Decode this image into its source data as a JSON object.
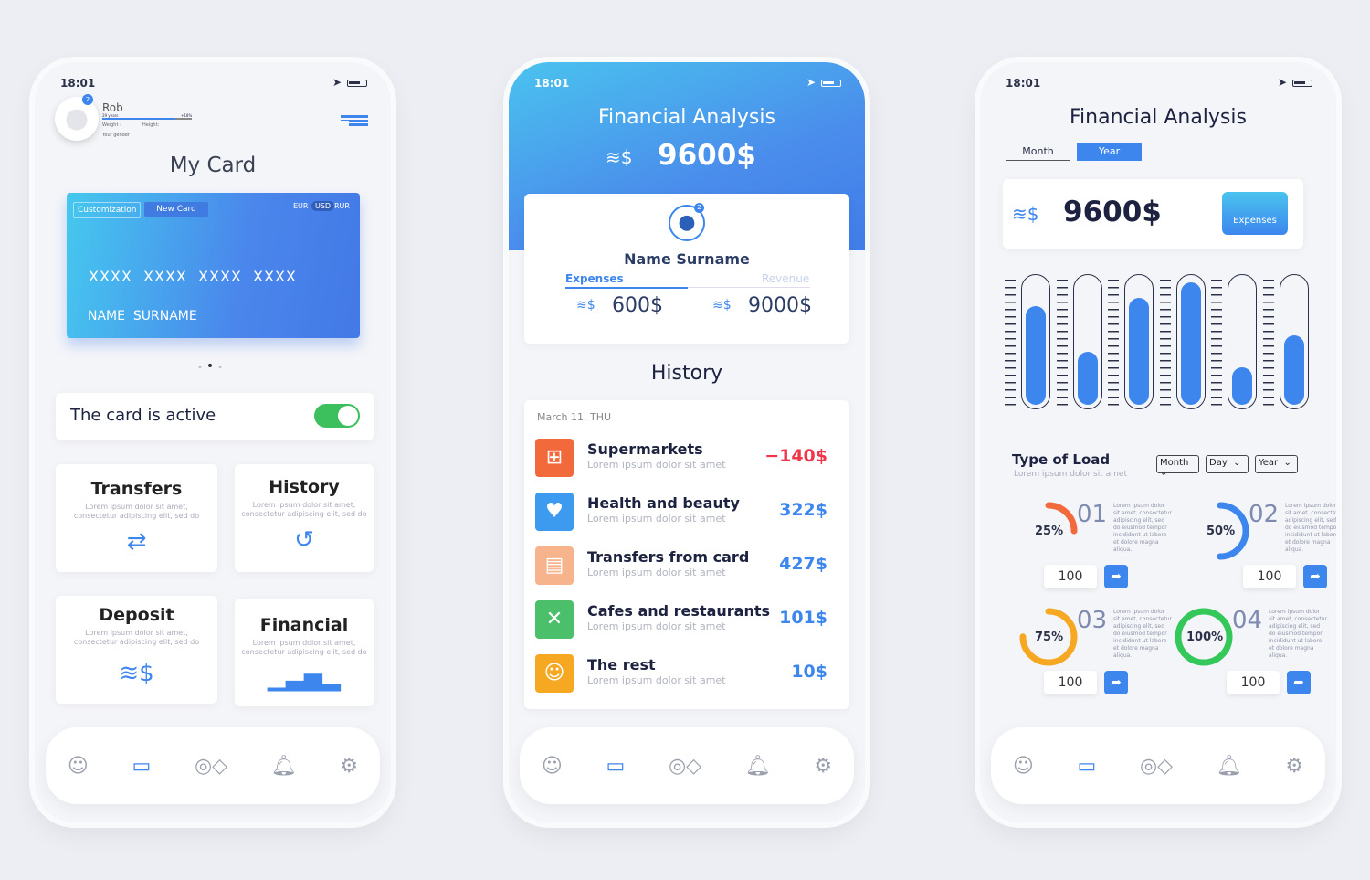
{
  "status": {
    "time": "18:01"
  },
  "phone1": {
    "profile": {
      "name": "Rob",
      "age": "29 years",
      "delta": "+18%",
      "weight_label": "Weight :",
      "height_label": "Height:",
      "gender_label": "Your gender :",
      "badge": "2"
    },
    "title": "My Card",
    "card": {
      "customization": "Customization",
      "new_card": "New Card",
      "currencies": [
        "EUR",
        "USD",
        "RUR"
      ],
      "selected_currency": "USD",
      "number": "XXXX  XXXX  XXXX  XXXX",
      "holder": "NAME  SURNAME"
    },
    "card_active": {
      "label": "The card is active",
      "on": true
    },
    "tiles": [
      {
        "title": "Transfers",
        "desc": "Lorem ipsum dolor sit amet, consectetur adipiscing elit, sed do",
        "icon": "transfer-icon"
      },
      {
        "title": "History",
        "desc": "Lorem ipsum dolor sit amet, consectetur adipiscing elit, sed do",
        "icon": "history-icon"
      },
      {
        "title": "Deposit",
        "desc": "Lorem ipsum dolor sit amet, consectetur adipiscing elit, sed do",
        "icon": "coins-icon"
      },
      {
        "title": "Financial",
        "desc": "Lorem ipsum dolor sit amet, consectetur adipiscing elit, sed do",
        "icon": "bar-chart-icon"
      }
    ]
  },
  "phone2": {
    "title": "Financial Analysis",
    "total": "9600$",
    "user": {
      "name": "Name Surname",
      "badge": "2"
    },
    "tabs": [
      "Expenses",
      "Revenue"
    ],
    "expenses": "600$",
    "revenue": "9000$",
    "history_title": "History",
    "date": "March 11, THU",
    "items": [
      {
        "title": "Supermarkets",
        "desc": "Lorem ipsum dolor sit amet",
        "amount": "−140$",
        "color": "#f26a3b",
        "icon": "basket-icon"
      },
      {
        "title": "Health and beauty",
        "desc": "Lorem ipsum dolor sit amet",
        "amount": "322$",
        "color": "#3d9bef",
        "icon": "heart-icon"
      },
      {
        "title": "Transfers from card",
        "desc": "Lorem ipsum dolor sit amet",
        "amount": "427$",
        "color": "#f7b48c",
        "icon": "card-icon"
      },
      {
        "title": "Cafes and restaurants",
        "desc": "Lorem ipsum dolor sit amet",
        "amount": "101$",
        "color": "#4cbf6a",
        "icon": "cutlery-icon"
      },
      {
        "title": "The rest",
        "desc": "Lorem ipsum dolor sit amet",
        "amount": "10$",
        "color": "#f7a823",
        "icon": "person-icon"
      }
    ]
  },
  "phone3": {
    "title": "Financial Analysis",
    "periods": [
      "Month",
      "Year"
    ],
    "active_period": "Year",
    "total": "9600$",
    "expenses_label": "Expenses",
    "bars": [
      0.78,
      0.42,
      0.85,
      0.97,
      0.3,
      0.55
    ],
    "load_title": "Type of Load",
    "load_sub": "Lorem ipsum dolor sit amet",
    "selects": [
      "Month",
      "Day",
      "Year"
    ],
    "gauges": [
      {
        "pct": 25,
        "label": "25%",
        "num": "01",
        "color": "#f26a3b",
        "value": "100"
      },
      {
        "pct": 50,
        "label": "50%",
        "num": "02",
        "color": "#3d86ee",
        "value": "100"
      },
      {
        "pct": 75,
        "label": "75%",
        "num": "03",
        "color": "#f7a823",
        "value": "100"
      },
      {
        "pct": 100,
        "label": "100%",
        "num": "04",
        "color": "#34c759",
        "value": "100"
      }
    ],
    "gauge_desc": "Lorem ipsum dolor sit amet, consectetur adipiscing elit, sed do eiusmod tempor incididunt ut labore et dolore magna aliqua."
  },
  "nav": [
    "user-icon",
    "card-icon",
    "contactless-icon",
    "bell-icon",
    "gear-icon"
  ]
}
